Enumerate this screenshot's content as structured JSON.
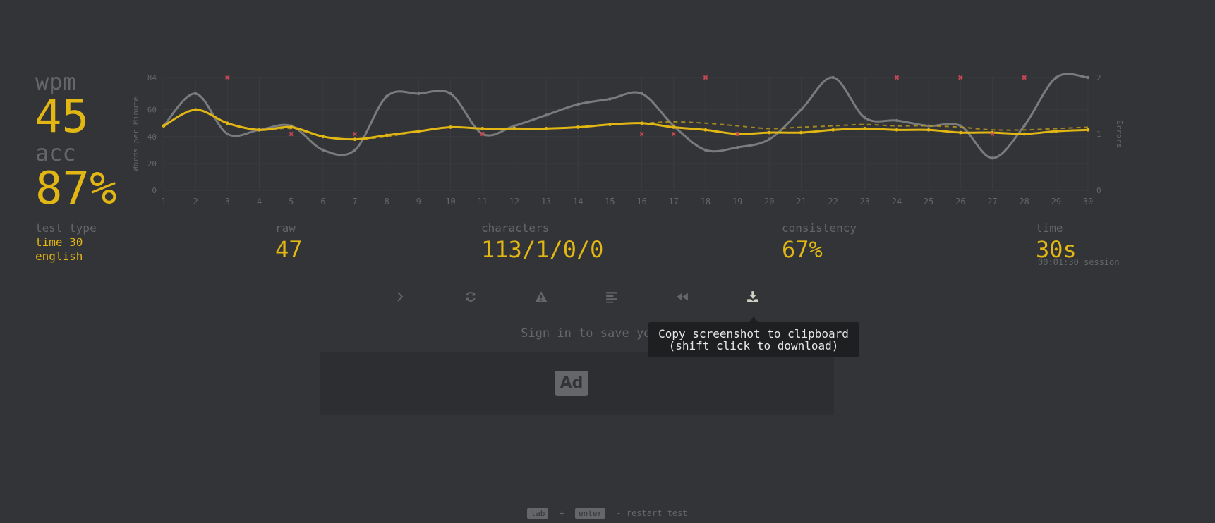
{
  "results": {
    "wpm_label": "wpm",
    "wpm_value": "45",
    "acc_label": "acc",
    "acc_value": "87%"
  },
  "stats": {
    "test_type_label": "test type",
    "test_type_mode": "time 30",
    "test_type_language": "english",
    "raw_label": "raw",
    "raw_value": "47",
    "characters_label": "characters",
    "characters_value": "113/1/0/0",
    "consistency_label": "consistency",
    "consistency_value": "67%",
    "time_label": "time",
    "time_value": "30s",
    "time_session": "00:01:30 session"
  },
  "actions": [
    {
      "name": "next-test",
      "icon": "chevron-right-icon"
    },
    {
      "name": "repeat-test",
      "icon": "refresh-icon"
    },
    {
      "name": "practice-words",
      "icon": "warning-icon"
    },
    {
      "name": "word-history",
      "icon": "align-left-icon"
    },
    {
      "name": "replay",
      "icon": "backward-icon"
    },
    {
      "name": "save-screenshot",
      "icon": "download-icon"
    }
  ],
  "tooltip": {
    "line1": "Copy screenshot to clipboard",
    "line2": "(shift click to download)"
  },
  "signin": {
    "link": "Sign in",
    "text": " to save your res"
  },
  "ad": {
    "label": "Ad"
  },
  "footer": {
    "key1": "tab",
    "plus": "+",
    "key2": "enter",
    "text": "- restart test"
  },
  "colors": {
    "background": "#323437",
    "sub": "#646669",
    "main": "#e2b714",
    "error": "#ca4754",
    "raw_line": "#7a7b7d"
  },
  "chart_data": {
    "type": "line",
    "x": [
      1,
      2,
      3,
      4,
      5,
      6,
      7,
      8,
      9,
      10,
      11,
      12,
      13,
      14,
      15,
      16,
      17,
      18,
      19,
      20,
      21,
      22,
      23,
      24,
      25,
      26,
      27,
      28,
      29,
      30
    ],
    "ylabel": "Words per Minute",
    "y2label": "Errors",
    "ylim": [
      0,
      84
    ],
    "yticks": [
      0,
      20,
      40,
      60,
      84
    ],
    "y2lim": [
      0,
      2
    ],
    "y2ticks": [
      0,
      1,
      2
    ],
    "grid": true,
    "series": [
      {
        "role": "wpm",
        "values": [
          48,
          60,
          50,
          45,
          47,
          40,
          38,
          41,
          44,
          47,
          46,
          46,
          46,
          47,
          49,
          50,
          47,
          45,
          42,
          43,
          43,
          45,
          46,
          45,
          45,
          43,
          43,
          42,
          44,
          45
        ]
      },
      {
        "role": "raw",
        "values": [
          48,
          72,
          42,
          45,
          48,
          30,
          30,
          70,
          72,
          72,
          42,
          48,
          56,
          64,
          68,
          72,
          48,
          30,
          32,
          38,
          60,
          84,
          54,
          52,
          48,
          48,
          24,
          48,
          84,
          84
        ]
      },
      {
        "role": "wpm-trend",
        "style": "dashed",
        "values": [
          48,
          60,
          50,
          45,
          46,
          40,
          38,
          40,
          44,
          47,
          46,
          46,
          46,
          47,
          49,
          50,
          51,
          50,
          48,
          46,
          47,
          48,
          49,
          48,
          48,
          47,
          45,
          45,
          46,
          47
        ]
      },
      {
        "role": "errors",
        "values": [
          0,
          0,
          2,
          0,
          1,
          0,
          1,
          0,
          0,
          0,
          1,
          0,
          0,
          0,
          0,
          1,
          1,
          2,
          1,
          0,
          0,
          0,
          0,
          2,
          0,
          2,
          1,
          2,
          0,
          0
        ]
      }
    ]
  }
}
